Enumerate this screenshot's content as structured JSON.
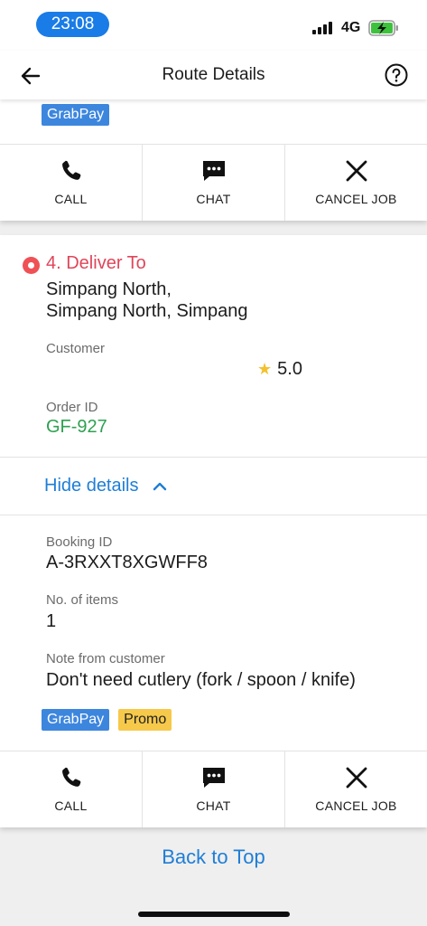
{
  "status_bar": {
    "time": "23:08",
    "network": "4G",
    "accent": "#1a7ce6"
  },
  "header": {
    "title": "Route Details",
    "back_icon": "arrow-left-icon",
    "help_icon": "question-circle-icon"
  },
  "previous_stop": {
    "payment_badge": "GrabPay",
    "actions": [
      {
        "label": "CALL",
        "icon": "phone-icon"
      },
      {
        "label": "CHAT",
        "icon": "chat-bubble-icon"
      },
      {
        "label": "CANCEL JOB",
        "icon": "close-icon"
      }
    ]
  },
  "stop": {
    "title": "4. Deliver To",
    "address_line1": "Simpang North,",
    "address_line2": "Simpang North, Simpang",
    "customer_label": "Customer",
    "rating": "5.0",
    "order_id_label": "Order ID",
    "order_id": "GF-927",
    "toggle_label": "Hide details",
    "booking_id_label": "Booking ID",
    "booking_id": "A-3RXXT8XGWFF8",
    "items_label": "No. of items",
    "items": "1",
    "note_label": "Note from customer",
    "note": "Don't need cutlery (fork / spoon / knife)",
    "badges": [
      "GrabPay",
      "Promo"
    ],
    "actions": [
      {
        "label": "CALL",
        "icon": "phone-icon"
      },
      {
        "label": "CHAT",
        "icon": "chat-bubble-icon"
      },
      {
        "label": "CANCEL JOB",
        "icon": "close-icon"
      }
    ]
  },
  "footer": {
    "back_to_top": "Back to Top"
  },
  "colors": {
    "primary_blue": "#1e7ed6",
    "destination_red": "#e0455a",
    "order_green": "#2ea14f",
    "grabpay_blue": "#3d86de",
    "promo_yellow": "#f6c94b"
  }
}
